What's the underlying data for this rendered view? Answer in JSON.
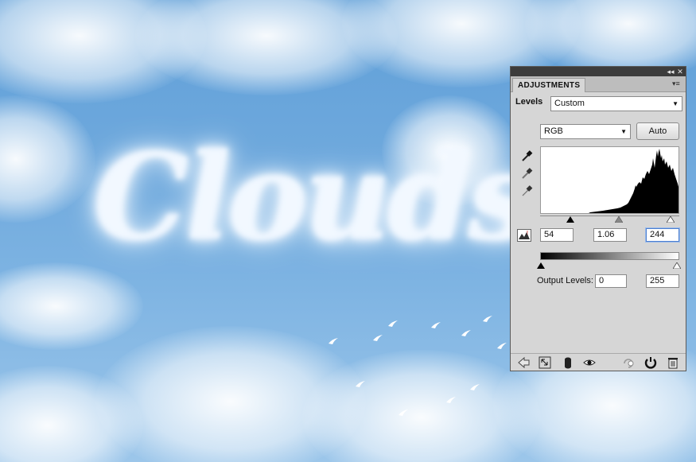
{
  "canvas": {
    "cloud_text": "Clouds"
  },
  "panel": {
    "tab_label": "ADJUSTMENTS",
    "collapse_icon": "double-chevron-left-icon",
    "close_icon": "close-icon",
    "menu_icon": "panel-menu-icon",
    "preset_label": "Levels",
    "preset_value": "Custom",
    "channel_value": "RGB",
    "auto_label": "Auto",
    "input_levels": {
      "black": "54",
      "gamma": "1.06",
      "white": "244"
    },
    "output_label": "Output Levels:",
    "output_levels": {
      "black": "0",
      "white": "255"
    },
    "eyedroppers": [
      "black-eyedropper-icon",
      "gray-eyedropper-icon",
      "white-eyedropper-icon"
    ],
    "bottom_icons": [
      "back-arrow-icon",
      "expand-view-icon",
      "clip-layer-icon",
      "visibility-eye-icon",
      "view-previous-icon",
      "reset-icon",
      "trash-icon"
    ]
  }
}
